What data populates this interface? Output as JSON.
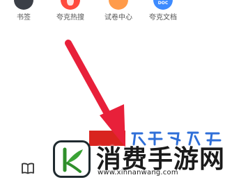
{
  "shortcuts": [
    {
      "label": "书签",
      "icon": "bookmark-icon"
    },
    {
      "label": "夸克热搜",
      "icon": "hot-search-icon"
    },
    {
      "label": "试卷中心",
      "icon": "exam-center-icon"
    },
    {
      "label": "夸克文档",
      "icon": "docs-icon",
      "badge": "DOC"
    }
  ],
  "bottom_bar": {
    "icon": "book-icon"
  },
  "arrow": {
    "icon": "red-arrow-pointer",
    "color": "#e8203a"
  },
  "watermark": {
    "title": "消费手游网",
    "url": "www.xinnanwang.com",
    "logo_icon": "leaf-k-logo",
    "logo_color": "#3aa335"
  }
}
